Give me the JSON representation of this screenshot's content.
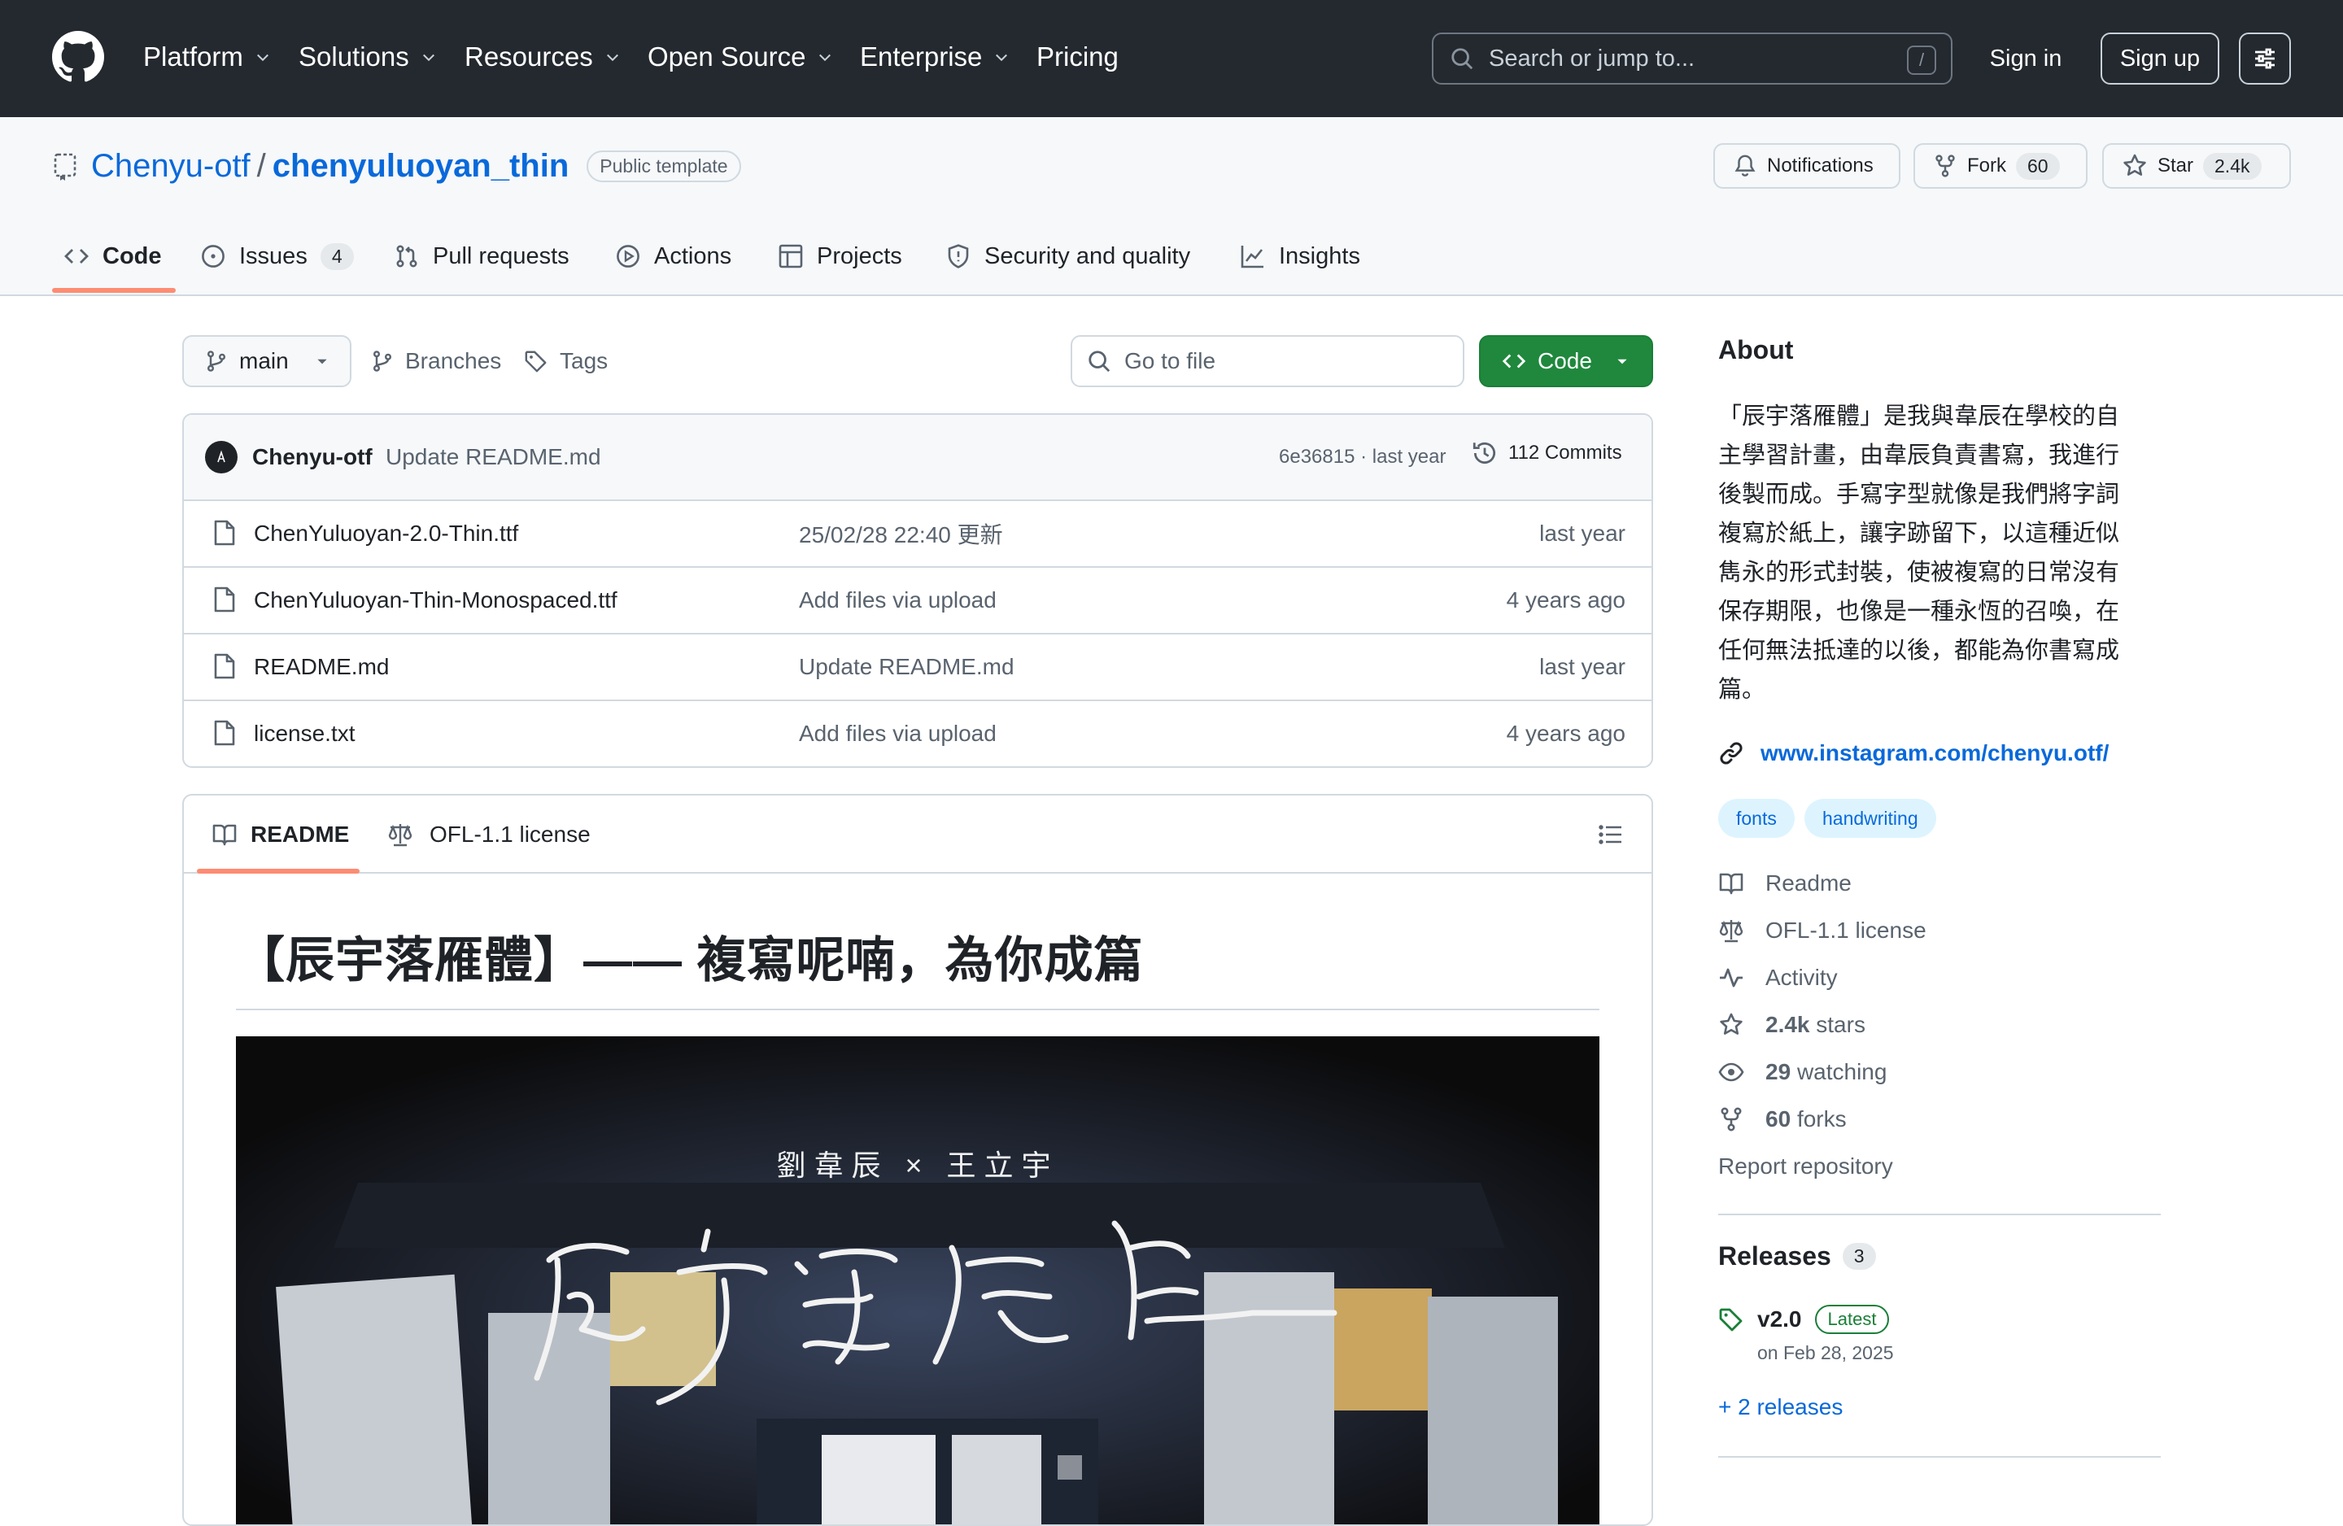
{
  "colors": {
    "header_bg": "#24292f",
    "accent": "#fd8c73",
    "link": "#0969da",
    "code_button": "#1f883d"
  },
  "header": {
    "nav": [
      "Platform",
      "Solutions",
      "Resources",
      "Open Source",
      "Enterprise",
      "Pricing"
    ],
    "search_placeholder": "Search or jump to...",
    "search_shortcut": "/",
    "sign_in": "Sign in",
    "sign_up": "Sign up"
  },
  "repo": {
    "owner": "Chenyu-otf",
    "separator": "/",
    "name": "chenyuluoyan_thin",
    "visibility": "Public template",
    "notifications": "Notifications",
    "fork_label": "Fork",
    "fork_count": "60",
    "star_label": "Star",
    "star_count": "2.4k"
  },
  "tabs": {
    "code": "Code",
    "issues": "Issues",
    "issues_count": "4",
    "pulls": "Pull requests",
    "actions": "Actions",
    "projects": "Projects",
    "security": "Security and quality",
    "insights": "Insights"
  },
  "toolbar": {
    "branch": "main",
    "branches": "Branches",
    "tags": "Tags",
    "goto_file": "Go to file",
    "code_button": "Code"
  },
  "commit": {
    "author": "Chenyu-otf",
    "message": "Update README.md",
    "hash_time": "6e36815 · last year",
    "commits": "112 Commits"
  },
  "files": [
    {
      "name": "ChenYuluoyan-2.0-Thin.ttf",
      "message": "25/02/28 22:40 更新",
      "date": "last year"
    },
    {
      "name": "ChenYuluoyan-Thin-Monospaced.ttf",
      "message": "Add files via upload",
      "date": "4 years ago"
    },
    {
      "name": "README.md",
      "message": "Update README.md",
      "date": "last year"
    },
    {
      "name": "license.txt",
      "message": "Add files via upload",
      "date": "4 years ago"
    }
  ],
  "readme": {
    "tab_readme": "README",
    "tab_license": "OFL-1.1 license",
    "heading": "【辰宇落雁體】—— 複寫呢喃，為你成篇",
    "banner_subtitle": "劉韋辰 × 王立宇"
  },
  "about": {
    "title": "About",
    "description_lines": [
      "「辰宇落雁體」是我與韋辰在學校的自",
      "主學習計畫，由韋辰負責書寫，我進行",
      "後製而成。手寫字型就像是我們將字詞",
      "複寫於紙上，讓字跡留下，以這種近似",
      "雋永的形式封裝，使被複寫的日常沒有",
      "保存期限，也像是一種永恆的召喚，在",
      "任何無法抵達的以後，都能為你書寫成",
      "篇。"
    ],
    "link": "www.instagram.com/chenyu.otf/",
    "topics": [
      "fonts",
      "handwriting"
    ],
    "readme": "Readme",
    "license": "OFL-1.1 license",
    "activity": "Activity",
    "stars_count": "2.4k",
    "stars_label": "stars",
    "watching_count": "29",
    "watching_label": "watching",
    "forks_count": "60",
    "forks_label": "forks",
    "report": "Report repository"
  },
  "releases": {
    "title": "Releases",
    "count": "3",
    "tag": "v2.0",
    "latest": "Latest",
    "date": "on Feb 28, 2025",
    "more": "+ 2 releases"
  }
}
